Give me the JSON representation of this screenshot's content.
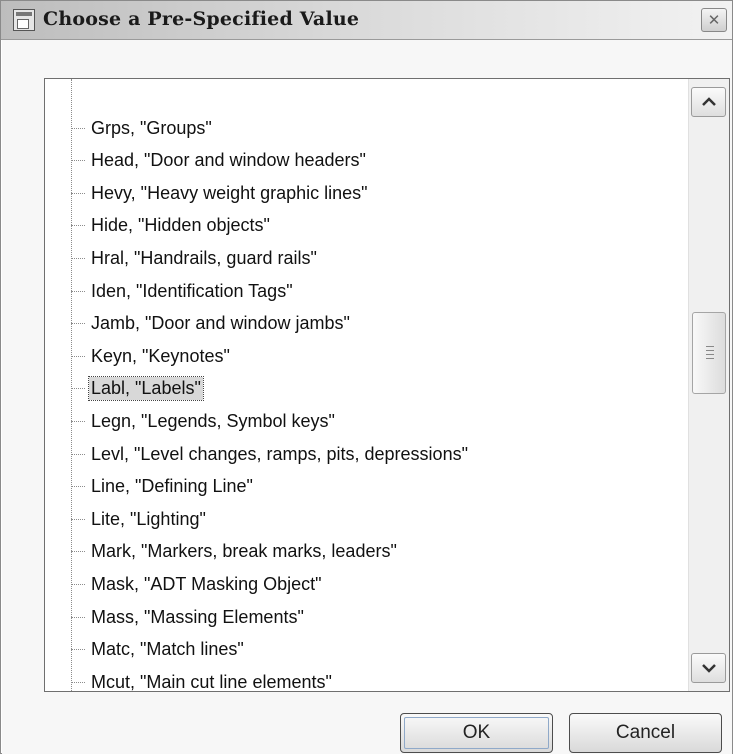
{
  "window": {
    "title": "Choose a Pre-Specified Value",
    "close_icon": "close-icon"
  },
  "list": {
    "items": [
      {
        "text": "Grps, \"Groups\"",
        "selected": false
      },
      {
        "text": "Head, \"Door and window headers\"",
        "selected": false
      },
      {
        "text": "Hevy, \"Heavy weight graphic lines\"",
        "selected": false
      },
      {
        "text": "Hide, \"Hidden objects\"",
        "selected": false
      },
      {
        "text": "Hral, \"Handrails, guard rails\"",
        "selected": false
      },
      {
        "text": "Iden, \"Identification Tags\"",
        "selected": false
      },
      {
        "text": "Jamb, \"Door and window jambs\"",
        "selected": false
      },
      {
        "text": "Keyn, \"Keynotes\"",
        "selected": false
      },
      {
        "text": "Labl, \"Labels\"",
        "selected": true
      },
      {
        "text": "Legn, \"Legends, Symbol keys\"",
        "selected": false
      },
      {
        "text": "Levl, \"Level changes, ramps, pits, depressions\"",
        "selected": false
      },
      {
        "text": "Line, \"Defining Line\"",
        "selected": false
      },
      {
        "text": "Lite, \"Lighting\"",
        "selected": false
      },
      {
        "text": "Mark, \"Markers, break marks, leaders\"",
        "selected": false
      },
      {
        "text": "Mask, \"ADT Masking Object\"",
        "selected": false
      },
      {
        "text": "Mass, \"Massing Elements\"",
        "selected": false
      },
      {
        "text": "Matc, \"Match lines\"",
        "selected": false
      },
      {
        "text": "Mcut, \"Main cut line elements\"",
        "selected": false
      }
    ]
  },
  "buttons": {
    "ok": "OK",
    "cancel": "Cancel"
  }
}
